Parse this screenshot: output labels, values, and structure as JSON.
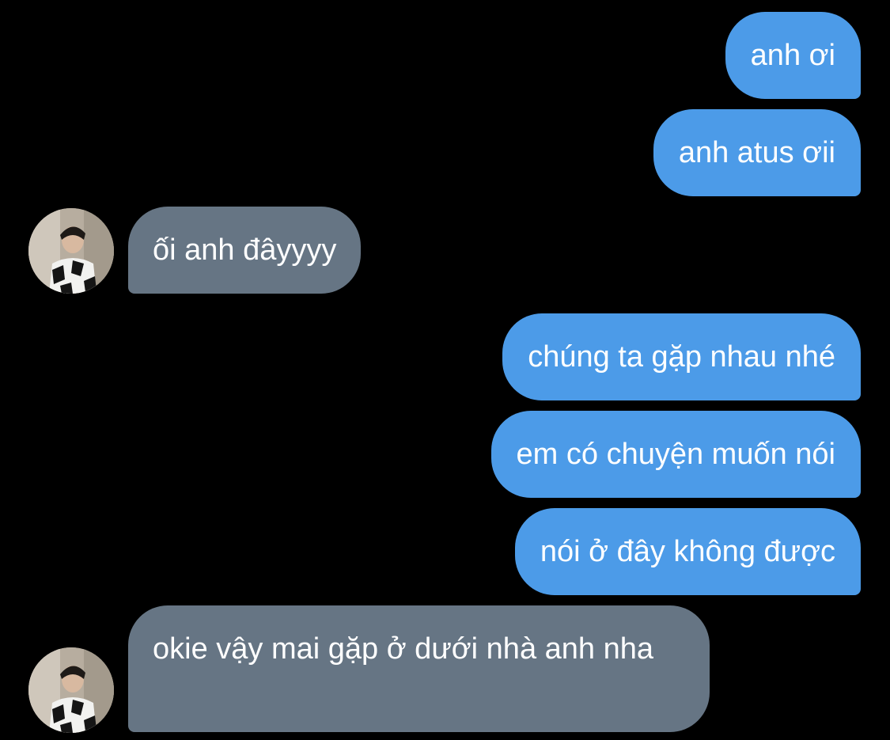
{
  "messages": [
    {
      "sender": "me",
      "text": "anh ơi"
    },
    {
      "sender": "me",
      "text": "anh atus ơii"
    },
    {
      "sender": "other",
      "text": "ối anh đâyyyy"
    },
    {
      "sender": "me",
      "text": "chúng ta gặp nhau nhé"
    },
    {
      "sender": "me",
      "text": "em có chuyện muốn nói"
    },
    {
      "sender": "me",
      "text": "nói ở đây không được"
    },
    {
      "sender": "other",
      "text": "okie vậy mai gặp ở dưới nhà anh nha"
    }
  ],
  "colors": {
    "background": "#000000",
    "outgoing_bubble": "#4c9be8",
    "incoming_bubble": "#667584",
    "text": "#ffffff"
  },
  "icons": {
    "avatar": "contact-avatar-photo"
  }
}
